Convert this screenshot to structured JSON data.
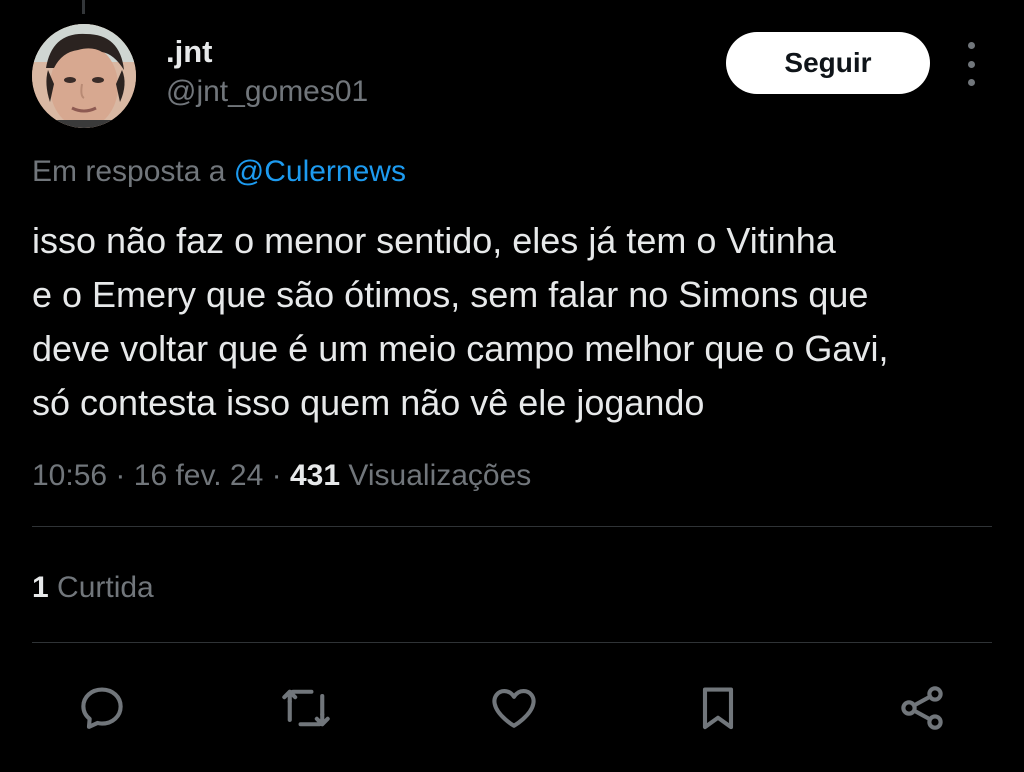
{
  "user": {
    "display_name": ".jnt",
    "handle": "@jnt_gomes01"
  },
  "follow_button": {
    "label": "Seguir"
  },
  "reply_to": {
    "prefix": "Em resposta a",
    "mention": "@Culernews"
  },
  "tweet": {
    "lines": [
      "isso não faz o menor sentido, eles já tem o Vitinha",
      "e o Emery que são ótimos, sem falar no Simons que",
      "deve voltar que é um meio campo melhor que o Gavi,",
      "só contesta isso quem não vê ele jogando"
    ]
  },
  "meta": {
    "time": "10:56",
    "date": "16 fev. 24",
    "separator": "·",
    "views_count": "431",
    "views_label": "Visualizações"
  },
  "likes": {
    "count": "1",
    "label": "Curtida"
  },
  "actions": [
    {
      "icon": "reply-icon"
    },
    {
      "icon": "retweet-icon"
    },
    {
      "icon": "like-icon"
    },
    {
      "icon": "bookmark-icon"
    },
    {
      "icon": "share-icon"
    }
  ],
  "colors": {
    "background": "#000000",
    "text_primary": "#e7e9ea",
    "text_secondary": "#71767b",
    "link": "#1d9bf0",
    "divider": "#2f3336",
    "follow_bg": "#ffffff",
    "icon": "#71767b"
  }
}
